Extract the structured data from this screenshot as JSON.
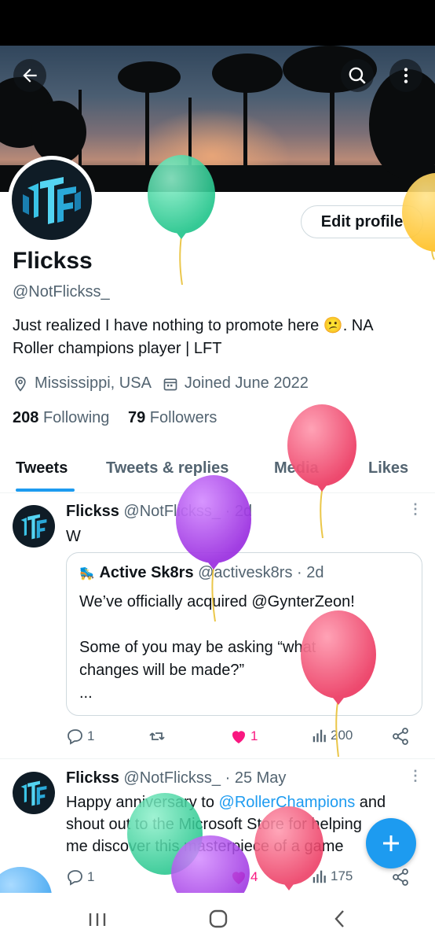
{
  "profile": {
    "name": "Flickss",
    "handle": "@NotFlickss_",
    "bio_line1": "Just realized I have nothing to promote here 😕.  NA",
    "bio_line2": "Roller champions player | LFT",
    "location": "Mississippi, USA",
    "joined": "Joined June 2022",
    "following_count": "208",
    "following_label": "Following",
    "followers_count": "79",
    "followers_label": "Followers",
    "edit_label": "Edit profile"
  },
  "tabs": [
    {
      "label": "Tweets"
    },
    {
      "label": "Tweets & replies"
    },
    {
      "label": "Media"
    },
    {
      "label": "Likes"
    }
  ],
  "tweets": [
    {
      "name": "Flickss",
      "meta": "@NotFlickss_ · 2d",
      "text": "W",
      "quote": {
        "name": "Active Sk8rs",
        "meta": "@activesk8rs · 2d",
        "line1": "We’ve officially acquired @GynterZeon!",
        "line2": "Some of you may be asking “what",
        "line3": "changes will be made?”",
        "line4": "..."
      },
      "replies": "1",
      "likes": "1",
      "views": "200"
    },
    {
      "name": "Flickss",
      "meta": "@NotFlickss_ · 25 May",
      "text_a": "Happy anniversary to ",
      "text_link": "@RollerChampions",
      "text_b": " and",
      "line2": "shout out to the Microsoft Store for helping",
      "line3": "me discover this masterpiece of a game",
      "replies": "1",
      "likes": "4",
      "views": "175"
    }
  ],
  "colors": {
    "accent": "#1d9bf0",
    "like": "#f91880",
    "balloon_green": "#2ed39a",
    "balloon_pink": "#f2496e",
    "balloon_purple": "#a03ae0",
    "balloon_yellow": "#ffc83a"
  },
  "icons": [
    "back-arrow-icon",
    "search-icon",
    "more-vert-icon",
    "location-icon",
    "calendar-icon",
    "reply-icon",
    "retweet-icon",
    "heart-icon",
    "views-icon",
    "share-icon",
    "compose-icon",
    "recents-icon",
    "home-icon",
    "back-icon"
  ]
}
